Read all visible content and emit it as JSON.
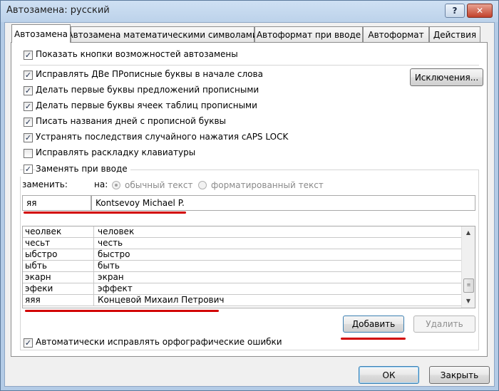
{
  "window": {
    "title": "Автозамена: русский",
    "help_glyph": "?",
    "close_glyph": "✕"
  },
  "tabs": [
    {
      "label": "Автозамена",
      "active": true
    },
    {
      "label": "Автозамена математическими символами",
      "active": false
    },
    {
      "label": "Автоформат при вводе",
      "active": false
    },
    {
      "label": "Автоформат",
      "active": false
    },
    {
      "label": "Действия",
      "active": false
    }
  ],
  "options": {
    "show_buttons": {
      "label": "Показать кнопки возможностей автозамены",
      "checked": true
    },
    "two_initial_caps": {
      "label": "Исправлять ДВе ПРописные буквы в начале слова",
      "checked": true
    },
    "capitalize_sentences": {
      "label": "Делать первые буквы предложений прописными",
      "checked": true
    },
    "capitalize_cells": {
      "label": "Делать первые буквы ячеек таблиц прописными",
      "checked": true
    },
    "capitalize_days": {
      "label": "Писать названия дней с прописной буквы",
      "checked": true
    },
    "caps_lock": {
      "label": "Устранять последствия случайного нажатия cAPS LOCK",
      "checked": true
    },
    "keyboard_layout": {
      "label": "Исправлять раскладку клавиатуры",
      "checked": false
    },
    "replace_as_you_type": {
      "label": "Заменять при вводе",
      "checked": true
    },
    "spelling": {
      "label": "Автоматически исправлять орфографические ошибки",
      "checked": true
    }
  },
  "exceptions_button": "Исключения...",
  "replace_label": "заменить:",
  "with_label": "на:",
  "radio_plain": "обычный текст",
  "radio_formatted": "форматированный текст",
  "replace_value": "яя",
  "with_value": "Kontsevoy Michael P.",
  "entries": [
    [
      "чеолвек",
      "человек"
    ],
    [
      "чесьт",
      "честь"
    ],
    [
      "ыбстро",
      "быстро"
    ],
    [
      "ыбть",
      "быть"
    ],
    [
      "экарн",
      "экран"
    ],
    [
      "эфеки",
      "эффект"
    ],
    [
      "яяя",
      "Концевой Михаил Петрович"
    ]
  ],
  "add_button": "Добавить",
  "delete_button": "Удалить",
  "ok_button": "ОК",
  "cancel_button": "Закрыть",
  "colors": {
    "annotation_red": "#d20000",
    "accent_blue": "#3c7fb1"
  },
  "icons": {
    "checkmark": "✓",
    "scroll_up": "▲",
    "scroll_down": "▼",
    "scroll_grip": "≡"
  }
}
